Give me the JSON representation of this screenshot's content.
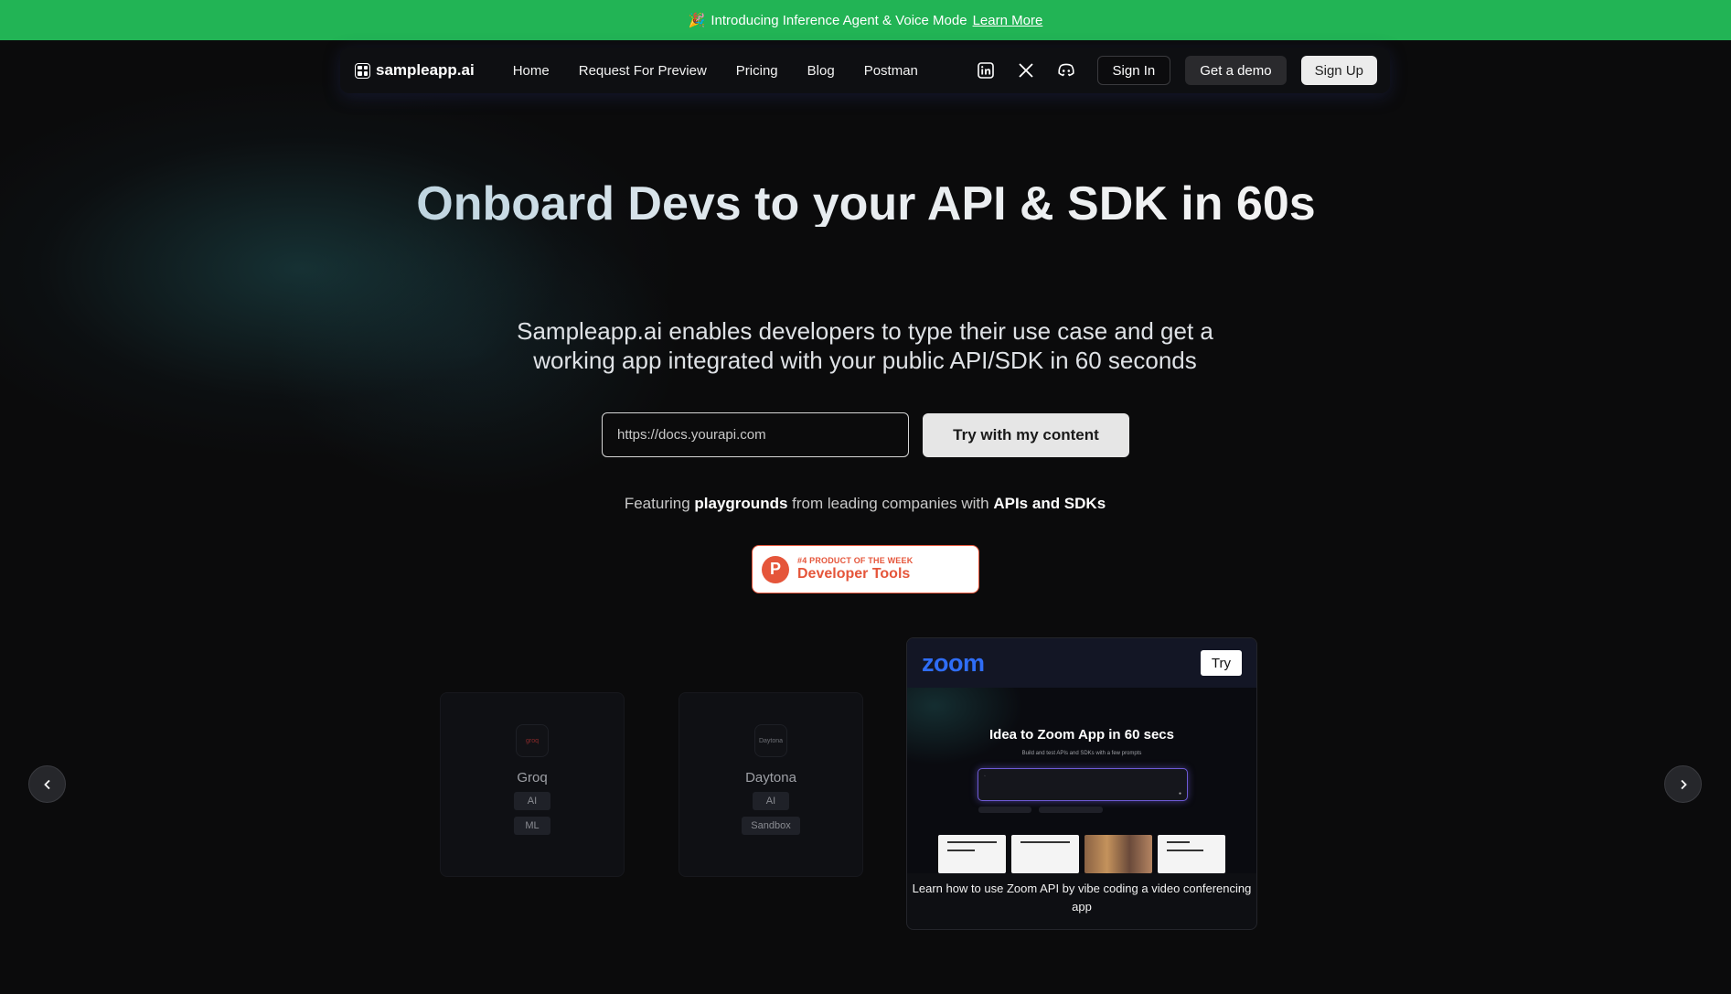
{
  "banner": {
    "text": "Introducing Inference Agent & Voice Mode",
    "link": "Learn More"
  },
  "nav": {
    "logo": "sampleapp.ai",
    "links": [
      "Home",
      "Request For Preview",
      "Pricing",
      "Blog",
      "Postman"
    ],
    "icons": [
      "linkedin-icon",
      "x-icon",
      "discord-icon"
    ],
    "sign_in": "Sign In",
    "get_demo": "Get a demo",
    "sign_up": "Sign Up"
  },
  "hero": {
    "title": "Onboard Devs to your API & SDK in 60s",
    "subtitle": "Sampleapp.ai enables developers to type their use case and get a working app integrated with your public API/SDK in 60 seconds",
    "input_placeholder": "https://docs.yourapi.com",
    "cta": "Try with my content",
    "featuring": {
      "p1": "Featuring",
      "b1": "playgrounds",
      "p2": "from leading companies with",
      "b2": "APIs and SDKs"
    }
  },
  "badge": {
    "logo_letter": "P",
    "rank": "#4 PRODUCT OF THE WEEK",
    "category": "Developer Tools",
    "color": "#e5553a"
  },
  "cards": [
    {
      "name": "Groq",
      "logo_text": "groq",
      "tags": [
        "AI",
        "ML"
      ]
    },
    {
      "name": "Daytona",
      "logo_text": "Daytona",
      "tags": [
        "AI",
        "Sandbox"
      ]
    }
  ],
  "featured": {
    "logo": "zoom",
    "try": "Try",
    "preview_title": "Idea to Zoom App in 60 secs",
    "preview_sub": "Build and test APIs and SDKs with a few prompts",
    "caption": "Learn how to use Zoom API by vibe coding a video conferencing app",
    "accent": "#2f6df6"
  },
  "colors": {
    "banner": "#22b455",
    "background": "#0b0b0c"
  }
}
